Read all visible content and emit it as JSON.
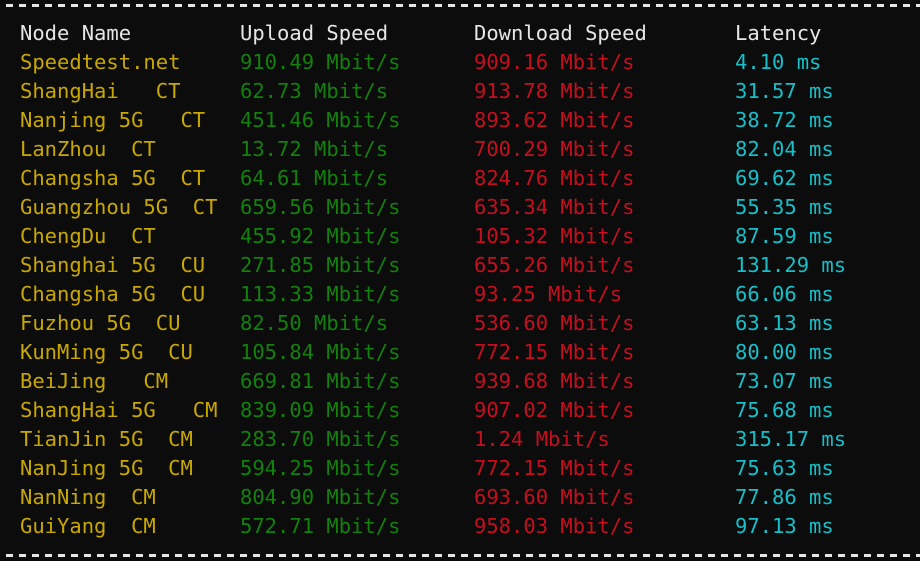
{
  "colors": {
    "background": "#0c0c0c",
    "header": "#e6e6e6",
    "node_name": "#c8a800",
    "upload": "#13800e",
    "download": "#c50f1f",
    "latency": "#17bfc8",
    "separator": "#e6e6e6"
  },
  "header": {
    "node_name": "Node Name",
    "upload": "Upload Speed",
    "download": "Download Speed",
    "latency": "Latency"
  },
  "rows": [
    {
      "node": "Speedtest.net",
      "upload": "910.49 Mbit/s",
      "download": "909.16 Mbit/s",
      "latency": "4.10 ms"
    },
    {
      "node": "ShangHai   CT",
      "upload": "62.73 Mbit/s",
      "download": "913.78 Mbit/s",
      "latency": "31.57 ms"
    },
    {
      "node": "Nanjing 5G   CT",
      "upload": "451.46 Mbit/s",
      "download": "893.62 Mbit/s",
      "latency": "38.72 ms"
    },
    {
      "node": "LanZhou  CT",
      "upload": "13.72 Mbit/s",
      "download": "700.29 Mbit/s",
      "latency": "82.04 ms"
    },
    {
      "node": "Changsha 5G  CT",
      "upload": "64.61 Mbit/s",
      "download": "824.76 Mbit/s",
      "latency": "69.62 ms"
    },
    {
      "node": "Guangzhou 5G  CT",
      "upload": "659.56 Mbit/s",
      "download": "635.34 Mbit/s",
      "latency": "55.35 ms"
    },
    {
      "node": "ChengDu  CT",
      "upload": "455.92 Mbit/s",
      "download": "105.32 Mbit/s",
      "latency": "87.59 ms"
    },
    {
      "node": "Shanghai 5G  CU",
      "upload": "271.85 Mbit/s",
      "download": "655.26 Mbit/s",
      "latency": "131.29 ms"
    },
    {
      "node": "Changsha 5G  CU",
      "upload": "113.33 Mbit/s",
      "download": "93.25 Mbit/s",
      "latency": "66.06 ms"
    },
    {
      "node": "Fuzhou 5G  CU",
      "upload": "82.50 Mbit/s",
      "download": "536.60 Mbit/s",
      "latency": "63.13 ms"
    },
    {
      "node": "KunMing 5G  CU",
      "upload": "105.84 Mbit/s",
      "download": "772.15 Mbit/s",
      "latency": "80.00 ms"
    },
    {
      "node": "BeiJing   CM",
      "upload": "669.81 Mbit/s",
      "download": "939.68 Mbit/s",
      "latency": "73.07 ms"
    },
    {
      "node": "ShangHai 5G   CM",
      "upload": "839.09 Mbit/s",
      "download": "907.02 Mbit/s",
      "latency": "75.68 ms"
    },
    {
      "node": "TianJin 5G  CM",
      "upload": "283.70 Mbit/s",
      "download": "1.24 Mbit/s",
      "latency": "315.17 ms"
    },
    {
      "node": "NanJing 5G  CM",
      "upload": "594.25 Mbit/s",
      "download": "772.15 Mbit/s",
      "latency": "75.63 ms"
    },
    {
      "node": "NanNing  CM",
      "upload": "804.90 Mbit/s",
      "download": "693.60 Mbit/s",
      "latency": "77.86 ms"
    },
    {
      "node": "GuiYang  CM",
      "upload": "572.71 Mbit/s",
      "download": "958.03 Mbit/s",
      "latency": "97.13 ms"
    }
  ]
}
